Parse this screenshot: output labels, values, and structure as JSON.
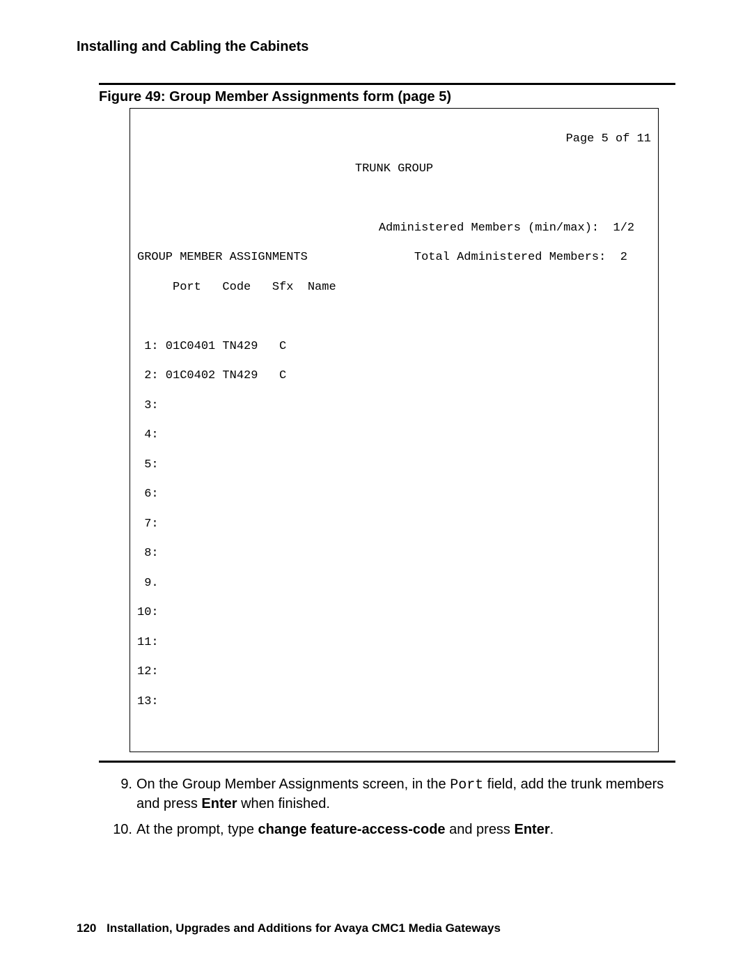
{
  "header": {
    "section_title": "Installing and Cabling the Cabinets"
  },
  "figure": {
    "caption": "Figure 49: Group Member Assignments form (page 5)"
  },
  "terminal": {
    "page_indicator": "Page 5 of 11",
    "screen_title": "TRUNK GROUP",
    "admin_minmax_label": "Administered Members (min/max):",
    "admin_minmax_value": "1/2",
    "group_heading": "GROUP MEMBER ASSIGNMENTS",
    "total_label": "Total Administered Members:",
    "total_value": "2",
    "columns_line": "     Port   Code   Sfx  Name",
    "rows": [
      " 1: 01C0401 TN429   C",
      " 2: 01C0402 TN429   C",
      " 3:",
      " 4:",
      " 5:",
      " 6:",
      " 7:",
      " 8:",
      " 9.",
      "10:",
      "11:",
      "12:",
      "13:"
    ]
  },
  "steps": {
    "s9_num": "9.",
    "s9_a": "On the Group Member Assignments screen, in the ",
    "s9_code": "Port",
    "s9_b": " field, add the trunk members and press ",
    "s9_enter": "Enter",
    "s9_c": " when finished.",
    "s10_num": "10.",
    "s10_a": "At the prompt, type ",
    "s10_cmd": "change feature-access-code",
    "s10_b": " and press ",
    "s10_enter": "Enter",
    "s10_c": "."
  },
  "footer": {
    "page_number": "120",
    "doc_title": "Installation, Upgrades and Additions for Avaya CMC1 Media Gateways"
  }
}
